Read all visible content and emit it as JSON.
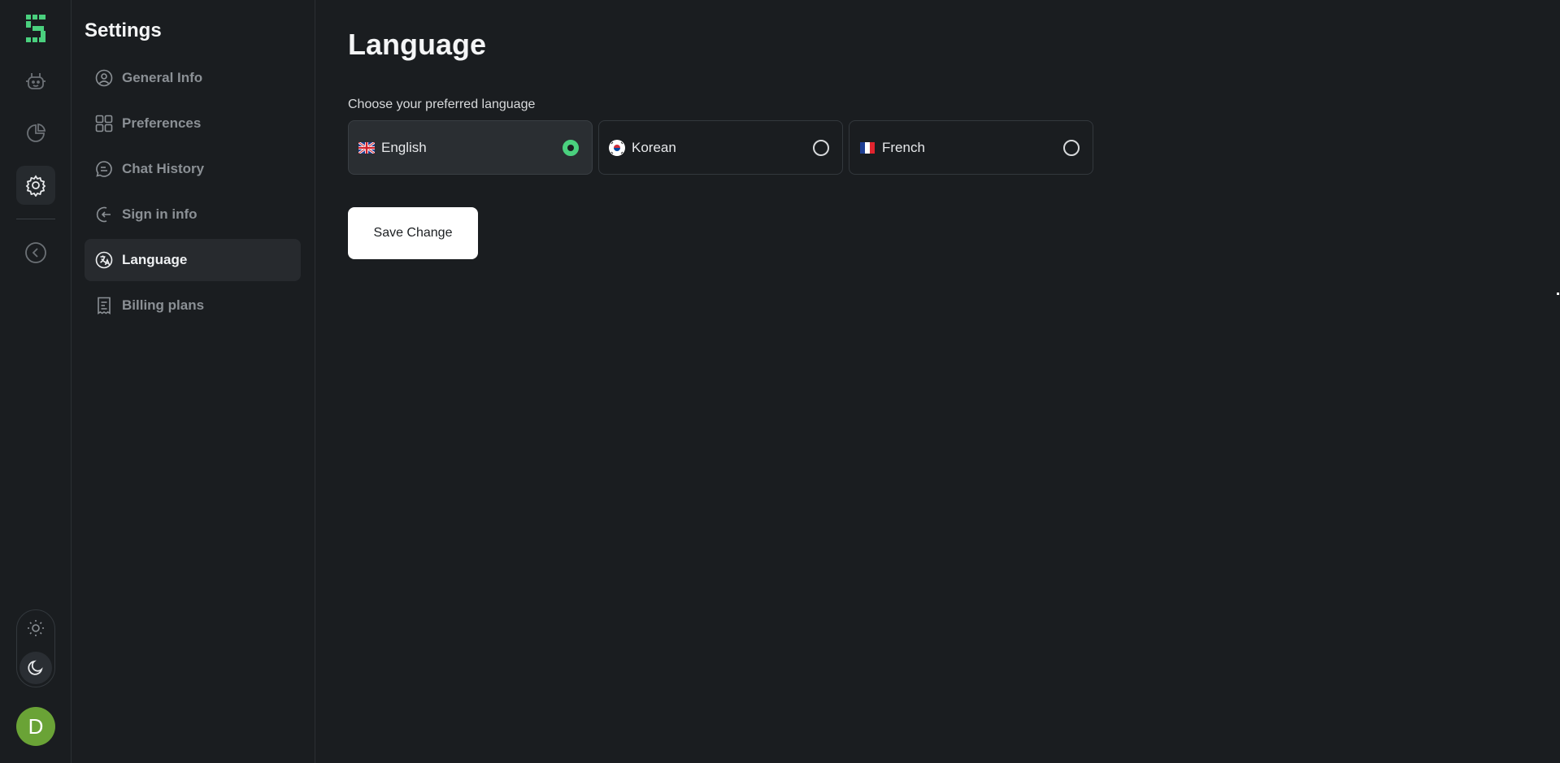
{
  "rail": {
    "items": [
      {
        "name": "bot-icon",
        "active": false
      },
      {
        "name": "pie-chart-icon",
        "active": false
      },
      {
        "name": "gear-icon",
        "active": true
      },
      {
        "name": "collapse-left-icon",
        "active": false
      }
    ],
    "avatar_initial": "D",
    "colors": {
      "brand": "#4ad07e",
      "avatar_bg": "#6aa336"
    }
  },
  "sidebar": {
    "title": "Settings",
    "items": [
      {
        "label": "General Info",
        "icon": "user-circle-icon",
        "active": false
      },
      {
        "label": "Preferences",
        "icon": "grid-icon",
        "active": false
      },
      {
        "label": "Chat History",
        "icon": "chat-bubble-icon",
        "active": false
      },
      {
        "label": "Sign in info",
        "icon": "sign-in-icon",
        "active": false
      },
      {
        "label": "Language",
        "icon": "translate-icon",
        "active": true
      },
      {
        "label": "Billing plans",
        "icon": "receipt-icon",
        "active": false
      }
    ]
  },
  "main": {
    "title": "Language",
    "prompt": "Choose your preferred language",
    "options": [
      {
        "label": "English",
        "flag": "uk-flag-icon",
        "selected": true
      },
      {
        "label": "Korean",
        "flag": "korea-flag-icon",
        "selected": false
      },
      {
        "label": "French",
        "flag": "france-flag-icon",
        "selected": false
      }
    ],
    "save_label": "Save Change"
  }
}
